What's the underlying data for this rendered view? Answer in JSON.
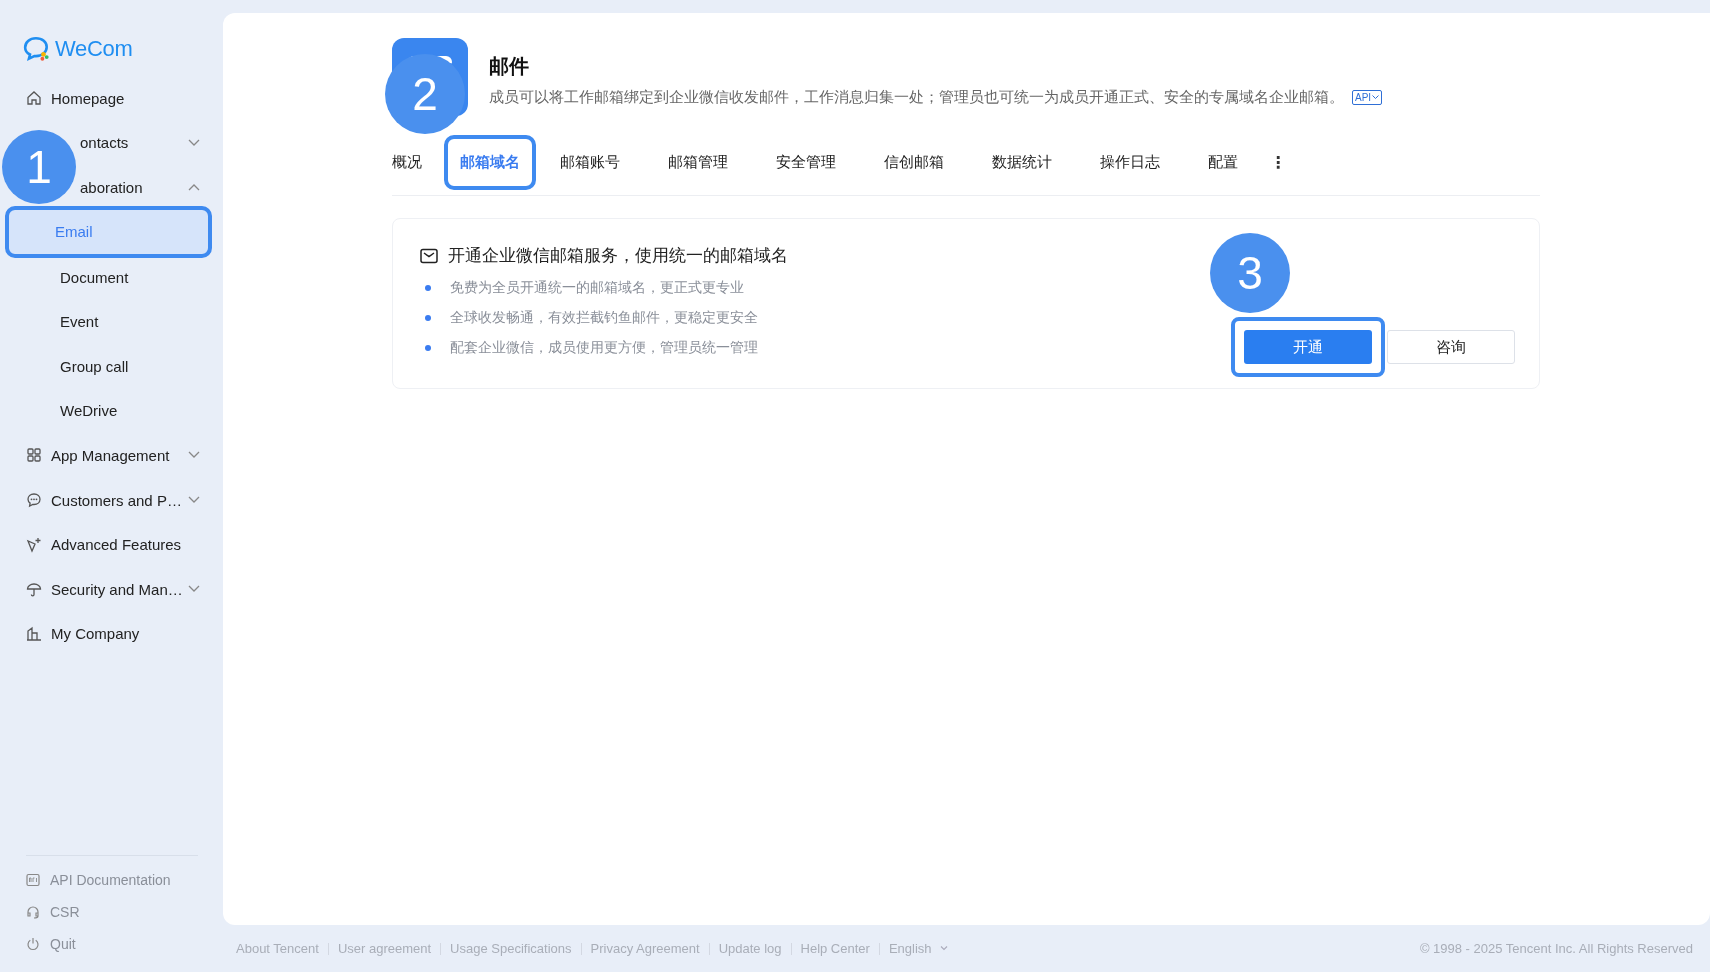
{
  "brand": {
    "name": "WeCom"
  },
  "sidebar": {
    "items": [
      {
        "label": "Homepage",
        "kind": "link",
        "expanded": false,
        "offset_by_callout": false
      },
      {
        "label": "ontacts",
        "kind": "group",
        "expanded": false,
        "offset_by_callout": true
      },
      {
        "label": "aboration",
        "kind": "group",
        "expanded": true,
        "offset_by_callout": true,
        "children": [
          {
            "label": "Email",
            "selected": true,
            "highlighted": true
          },
          {
            "label": "Document",
            "selected": false,
            "highlighted": false
          },
          {
            "label": "Event",
            "selected": false,
            "highlighted": false
          },
          {
            "label": "Group call",
            "selected": false,
            "highlighted": false
          },
          {
            "label": "WeDrive",
            "selected": false,
            "highlighted": false
          }
        ]
      },
      {
        "label": "App Management",
        "kind": "group",
        "expanded": false,
        "offset_by_callout": false
      },
      {
        "label": "Customers and P…",
        "kind": "group",
        "expanded": false,
        "offset_by_callout": false
      },
      {
        "label": "Advanced Features",
        "kind": "link",
        "expanded": false,
        "offset_by_callout": false
      },
      {
        "label": "Security and Man…",
        "kind": "group",
        "expanded": false,
        "offset_by_callout": false
      },
      {
        "label": "My Company",
        "kind": "link",
        "expanded": false,
        "offset_by_callout": false
      }
    ],
    "bottom_items": [
      {
        "label": "API Documentation"
      },
      {
        "label": "CSR"
      },
      {
        "label": "Quit"
      }
    ]
  },
  "header": {
    "title": "邮件",
    "description": "成员可以将工作邮箱绑定到企业微信收发邮件，工作消息归集一处；管理员也可统一为成员开通正式、安全的专属域名企业邮箱。",
    "api_badge": "API"
  },
  "tabs": [
    {
      "label": "概况",
      "selected": false,
      "highlighted": false
    },
    {
      "label": "邮箱域名",
      "selected": true,
      "highlighted": true
    },
    {
      "label": "邮箱账号",
      "selected": false,
      "highlighted": false
    },
    {
      "label": "邮箱管理",
      "selected": false,
      "highlighted": false
    },
    {
      "label": "安全管理",
      "selected": false,
      "highlighted": false
    },
    {
      "label": "信创邮箱",
      "selected": false,
      "highlighted": false
    },
    {
      "label": "数据统计",
      "selected": false,
      "highlighted": false
    },
    {
      "label": "操作日志",
      "selected": false,
      "highlighted": false
    },
    {
      "label": "配置",
      "selected": false,
      "highlighted": false
    }
  ],
  "tabs_more": "⋮",
  "card": {
    "title": "开通企业微信邮箱服务，使用统一的邮箱域名",
    "bullets": [
      "免费为全员开通统一的邮箱域名，更正式更专业",
      "全球收发畅通，有效拦截钓鱼邮件，更稳定更安全",
      "配套企业微信，成员使用更方便，管理员统一管理"
    ],
    "buttons": [
      {
        "label": "开通",
        "kind": "primary",
        "highlighted": true
      },
      {
        "label": "咨询",
        "kind": "secondary",
        "highlighted": false
      }
    ]
  },
  "callouts": [
    "1",
    "2",
    "3"
  ],
  "footer": {
    "links": [
      "About Tencent",
      "User agreement",
      "Usage Specifications",
      "Privacy Agreement",
      "Update log",
      "Help Center"
    ],
    "language": "English",
    "copyright": "© 1998 - 2025 Tencent Inc. All Rights Reserved"
  }
}
